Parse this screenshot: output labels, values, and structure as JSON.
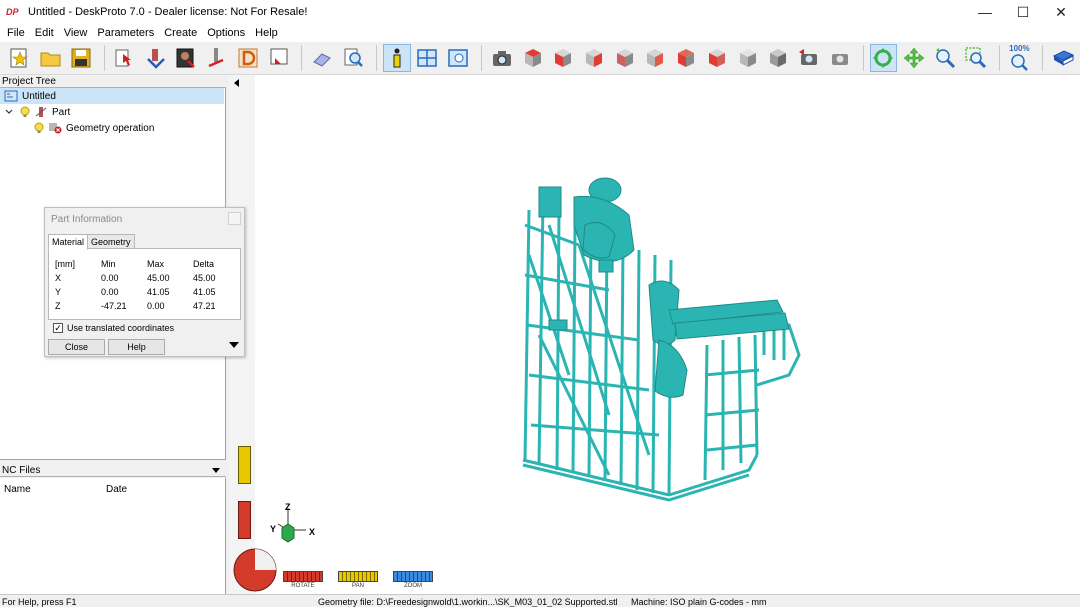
{
  "window": {
    "logo": "DP",
    "title": "Untitled - DeskProto 7.0 - Dealer license: Not For Resale!",
    "minimize": "—",
    "maximize": "☐",
    "close": "✕"
  },
  "menu": [
    "File",
    "Edit",
    "View",
    "Parameters",
    "Create",
    "Options",
    "Help"
  ],
  "toolbar": {
    "zoom_label": "100%",
    "cube_colors": {
      "red": "#e03c31",
      "grey": "#9a9a9a",
      "light": "#d6d6d6"
    }
  },
  "project_tree": {
    "header": "Project Tree",
    "items": [
      {
        "label": "Untitled"
      },
      {
        "label": "Part"
      },
      {
        "label": "Geometry operation"
      }
    ]
  },
  "part_info": {
    "title": "Part Information",
    "tabs": [
      "Material",
      "Geometry"
    ],
    "headers": [
      "[mm]",
      "Min",
      "Max",
      "Delta"
    ],
    "rows": [
      {
        "axis": "X",
        "min": "0.00",
        "max": "45.00",
        "delta": "45.00"
      },
      {
        "axis": "Y",
        "min": "0.00",
        "max": "41.05",
        "delta": "41.05"
      },
      {
        "axis": "Z",
        "min": "-47.21",
        "max": "0.00",
        "delta": "47.21"
      }
    ],
    "checkbox_label": "Use translated coordinates",
    "checkbox_checked": "✓",
    "close_label": "Close",
    "help_label": "Help"
  },
  "nc_files": {
    "header": "NC Files",
    "columns": [
      "Name",
      "Date"
    ]
  },
  "viewport": {
    "axis_labels": {
      "z": "Z",
      "y": "Y",
      "x": "X"
    },
    "model_color": "#2bb5b2",
    "mode_labels": [
      "ROTATE",
      "PAN",
      "ZOOM"
    ]
  },
  "status": {
    "help": "For Help, press F1",
    "geometry": "Geometry file: D:\\Freedesignwold\\1.workin...\\SK_M03_01_02 Supported.stl",
    "machine": "Machine: ISO plain G-codes - mm"
  }
}
